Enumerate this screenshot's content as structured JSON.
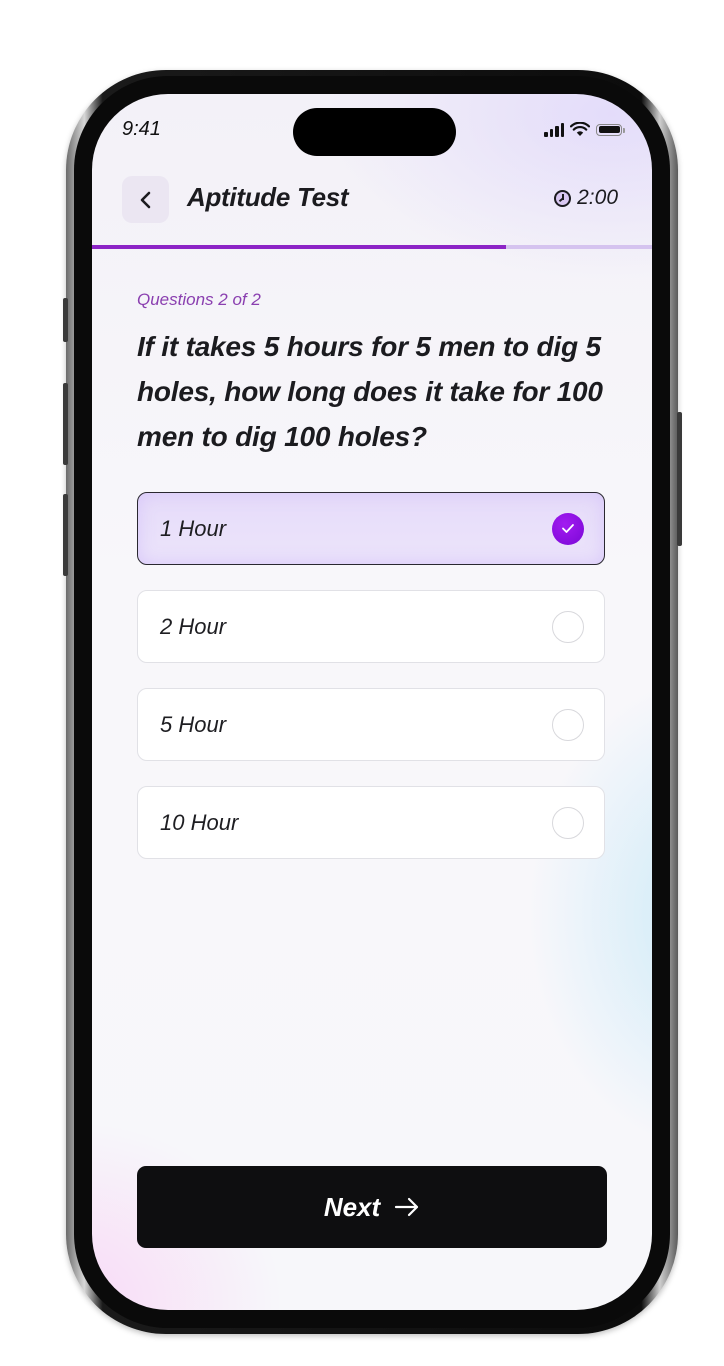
{
  "status_bar": {
    "time": "9:41"
  },
  "header": {
    "title": "Aptitude Test",
    "timer": "2:00",
    "icons": {
      "back": "chevron-left-icon",
      "timer": "clock-icon"
    }
  },
  "progress": {
    "fraction": 0.74
  },
  "question": {
    "counter": "Questions 2 of 2",
    "text": "If it takes 5 hours for 5 men to dig 5 holes, how long does it take for 100 men to dig 100 holes?"
  },
  "options": [
    {
      "label": "1 Hour",
      "selected": true
    },
    {
      "label": "2 Hour",
      "selected": false
    },
    {
      "label": "5 Hour",
      "selected": false
    },
    {
      "label": "10 Hour",
      "selected": false
    }
  ],
  "footer": {
    "next_label": "Next",
    "next_icon": "arrow-right-icon"
  },
  "colors": {
    "accent": "#8c24c6",
    "selected_bg": "#e6dcf9",
    "button_bg": "#0e0e10"
  }
}
